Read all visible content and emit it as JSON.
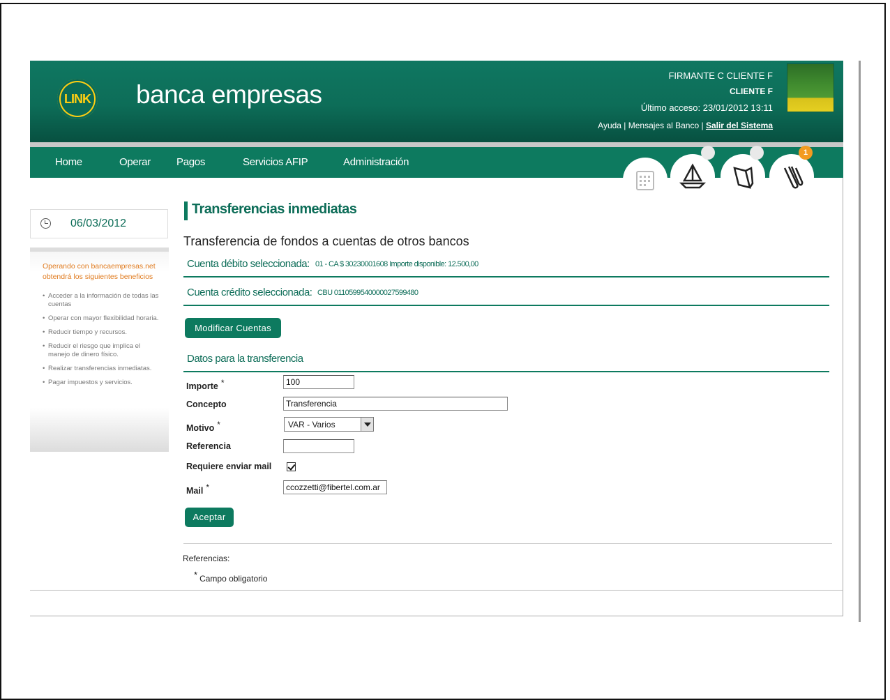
{
  "header": {
    "brand": "banca empresas",
    "logo_text": "LINK",
    "user_line1": "FIRMANTE C CLIENTE F",
    "user_line2": "CLIENTE F",
    "last_access": "Último acceso: 23/01/2012 13:11",
    "links": {
      "help": "Ayuda",
      "sep1": " | ",
      "messages": "Mensajes al Banco",
      "sep2": " | ",
      "logout": "Salir del Sistema"
    }
  },
  "nav": {
    "items": [
      "Home",
      "Operar",
      "Pagos",
      "Servicios AFIP",
      "Administración"
    ],
    "tools": [
      "calendar-icon",
      "sailboat-icon",
      "folder-icon",
      "paperclip-icon"
    ],
    "notification_badge": "1"
  },
  "sidebar": {
    "date": "06/03/2012",
    "promo_title": "Operando con bancaempresas.net obtendrá los siguientes beneficios",
    "benefits": [
      "Acceder a la información de todas las cuentas",
      "Operar con mayor flexibilidad horaria.",
      "Reducir tiempo y recursos.",
      "Reducir el riesgo que implica el manejo de dinero físico.",
      "Realizar transferencias inmediatas.",
      "Pagar impuestos y servicios."
    ]
  },
  "main": {
    "title": "Transferencias inmediatas",
    "subtitle": "Transferencia de fondos a cuentas de otros bancos",
    "debit_label": "Cuenta débito seleccionada:",
    "debit_value": "01 - CA $ 30230001608  Importe disponible: 12.500,00",
    "credit_label": "Cuenta crédito seleccionada:",
    "credit_value": "CBU 0110599540000027599480",
    "modify_button": "Modificar Cuentas",
    "section_title": "Datos para la transferencia",
    "form": {
      "importe_label": "Importe",
      "importe_value": "100",
      "concepto_label": "Concepto",
      "concepto_value": "Transferencia",
      "motivo_label": "Motivo",
      "motivo_value": "VAR - Varios",
      "referencia_label": "Referencia",
      "referencia_value": "",
      "mail_required_label": "Requiere enviar mail",
      "mail_required_checked": true,
      "mail_label": "Mail",
      "mail_value": "ccozzetti@fibertel.com.ar",
      "required_mark": "*"
    },
    "accept_button": "Aceptar",
    "references_title": "Referencias:",
    "references_note": "Campo obligatorio"
  },
  "colors": {
    "primary_green": "#0d7a5f",
    "accent_orange": "#e07b1f",
    "logo_yellow": "#ffcf13"
  }
}
